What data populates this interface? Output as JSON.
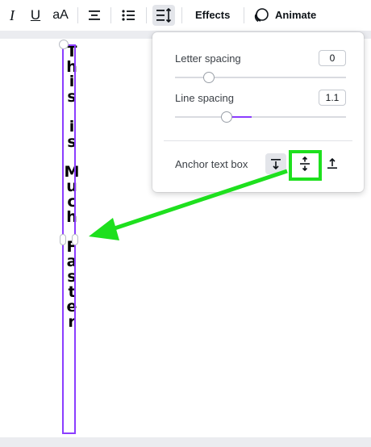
{
  "toolbar": {
    "italic_label": "I",
    "underline_label": "U",
    "case_label": "aA",
    "effects_label": "Effects",
    "animate_label": "Animate",
    "icons": [
      "italic-icon",
      "underline-icon",
      "case-icon",
      "align-center-icon",
      "bulleted-list-icon",
      "spacing-icon",
      "animate-icon"
    ]
  },
  "canvas": {
    "vertical_text": [
      "T",
      "h",
      "i",
      "s",
      "",
      "i",
      "s",
      "",
      "M",
      "u",
      "c",
      "h",
      "",
      "F",
      "a",
      "s",
      "t",
      "e",
      "r"
    ]
  },
  "spacing_popover": {
    "letter_spacing_label": "Letter spacing",
    "letter_spacing_value": "0",
    "letter_spacing_level": 0.2,
    "line_spacing_label": "Line spacing",
    "line_spacing_value": "1.1",
    "line_spacing_level": 0.3,
    "anchor_label": "Anchor text box",
    "anchor_options": [
      "anchor-top-icon",
      "anchor-middle-icon",
      "anchor-bottom-icon"
    ]
  },
  "colors": {
    "accent": "#8b3dff",
    "annotation": "#1ee01e",
    "selected_bg": "#e3e5ea"
  }
}
